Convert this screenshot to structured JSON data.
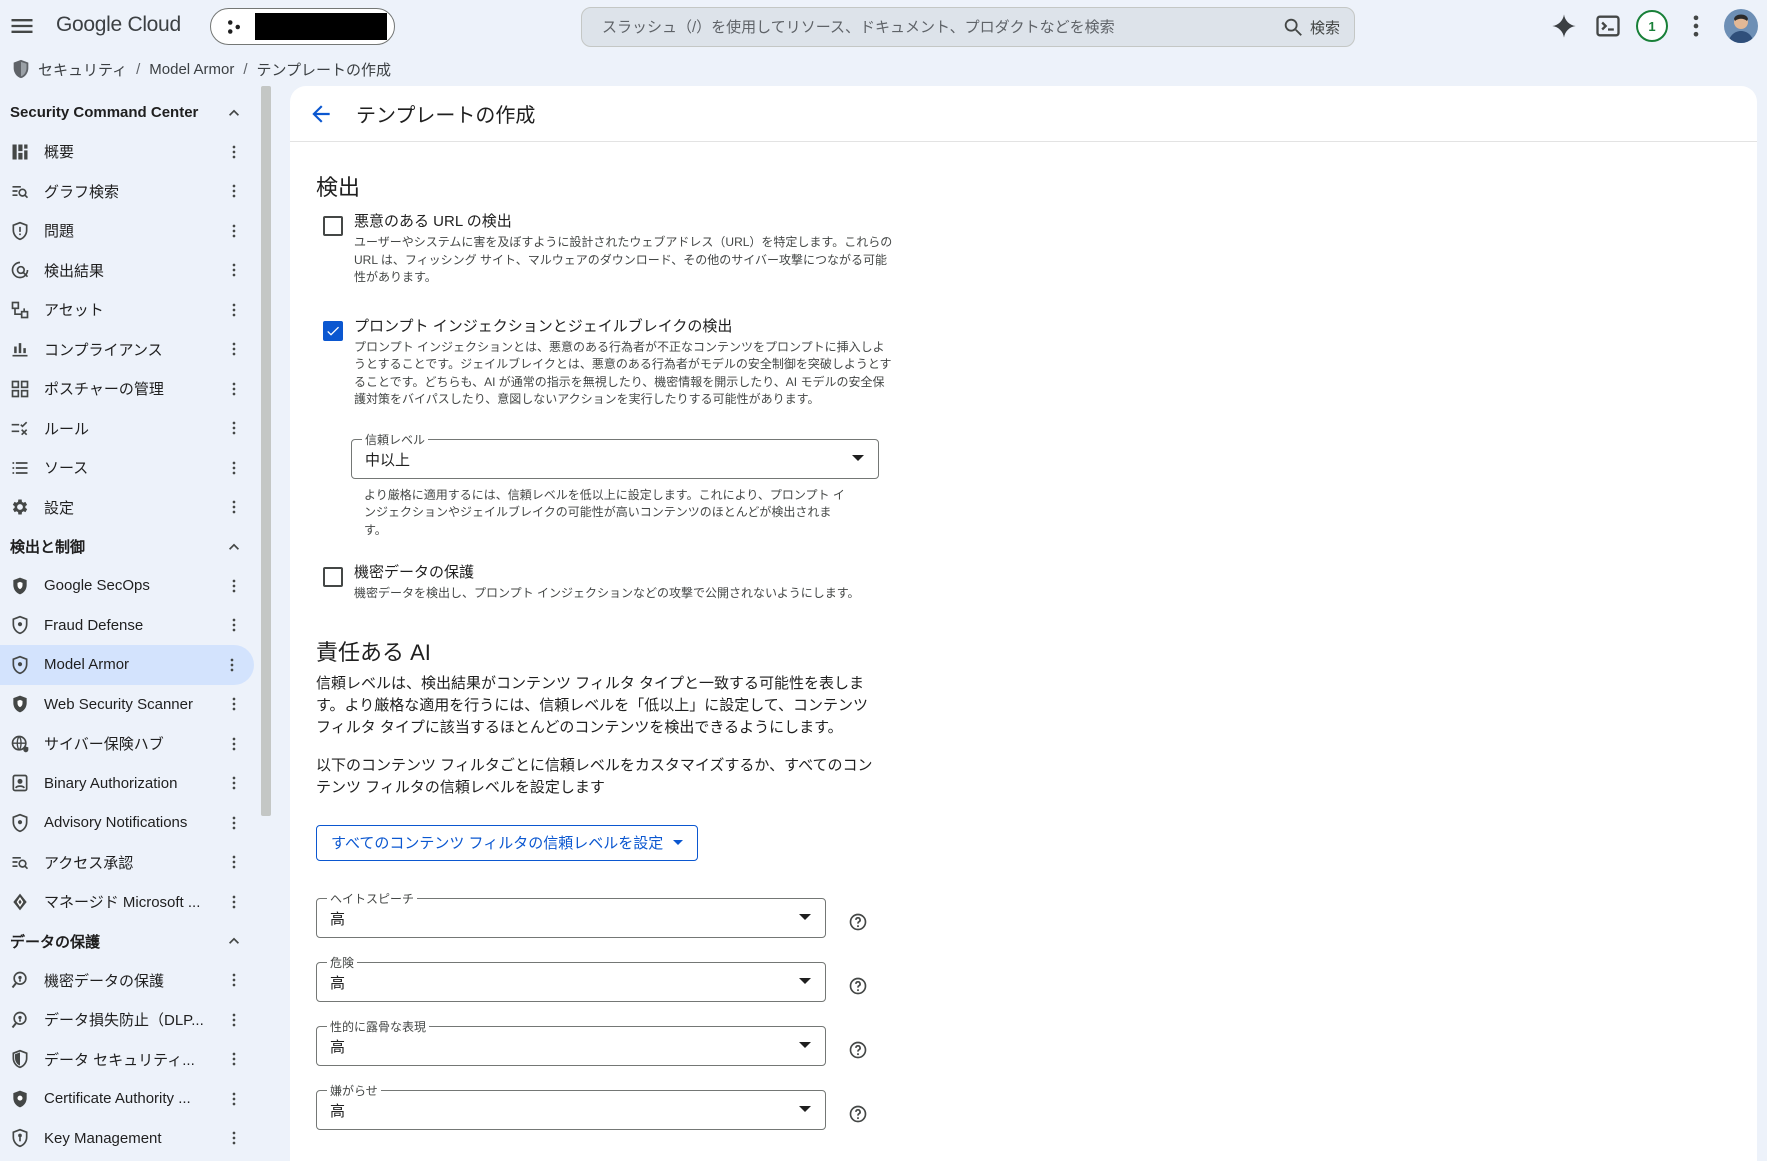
{
  "topbar": {
    "logo": "Google Cloud",
    "search_placeholder": "スラッシュ（/）を使用してリソース、ドキュメント、プロダクトなどを検索",
    "search_button": "検索",
    "notification_count": "1"
  },
  "breadcrumb": [
    "セキュリティ",
    "Model Armor",
    "テンプレートの作成"
  ],
  "sidebar": {
    "sections": [
      {
        "title": "Security Command Center",
        "items": [
          {
            "label": "概要",
            "icon": "dashboard-icon"
          },
          {
            "label": "グラフ検索",
            "icon": "graph-search-icon"
          },
          {
            "label": "問題",
            "icon": "shield-issue-icon"
          },
          {
            "label": "検出結果",
            "icon": "findings-icon"
          },
          {
            "label": "アセット",
            "icon": "asset-icon"
          },
          {
            "label": "コンプライアンス",
            "icon": "compliance-icon"
          },
          {
            "label": "ポスチャーの管理",
            "icon": "posture-icon"
          },
          {
            "label": "ルール",
            "icon": "rule-icon"
          },
          {
            "label": "ソース",
            "icon": "source-icon"
          },
          {
            "label": "設定",
            "icon": "gear-icon"
          }
        ]
      },
      {
        "title": "検出と制御",
        "items": [
          {
            "label": "Google SecOps",
            "icon": "shield-icon"
          },
          {
            "label": "Fraud Defense",
            "icon": "shield-outline-icon"
          },
          {
            "label": "Model Armor",
            "icon": "shield-outline-icon",
            "active": true
          },
          {
            "label": "Web Security Scanner",
            "icon": "shield-icon"
          },
          {
            "label": "サイバー保険ハブ",
            "icon": "globe-icon"
          },
          {
            "label": "Binary Authorization",
            "icon": "badge-icon"
          },
          {
            "label": "Advisory Notifications",
            "icon": "shield-outline-icon"
          },
          {
            "label": "アクセス承認",
            "icon": "access-icon"
          },
          {
            "label": "マネージド Microsoft ...",
            "icon": "microsoft-icon"
          }
        ]
      },
      {
        "title": "データの保護",
        "items": [
          {
            "label": "機密データの保護",
            "icon": "key-search-icon"
          },
          {
            "label": "データ損失防止（DLP...",
            "icon": "key-search-icon"
          },
          {
            "label": "データ セキュリティ...",
            "icon": "shield-half-icon"
          },
          {
            "label": "Certificate Authority ...",
            "icon": "shield-cert-icon"
          },
          {
            "label": "Key Management",
            "icon": "shield-key-icon"
          }
        ]
      }
    ]
  },
  "page": {
    "title": "テンプレートの作成",
    "detection": {
      "heading": "検出",
      "malicious_url": {
        "label": "悪意のある URL の検出",
        "checked": false,
        "desc": "ユーザーやシステムに害を及ぼすように設計されたウェブアドレス（URL）を特定します。これらの URL は、フィッシング サイト、マルウェアのダウンロード、その他のサイバー攻撃につながる可能性があります。"
      },
      "prompt_injection": {
        "label": "プロンプト インジェクションとジェイルブレイクの検出",
        "checked": true,
        "desc": "プロンプト インジェクションとは、悪意のある行為者が不正なコンテンツをプロンプトに挿入しようとすることです。ジェイルブレイクとは、悪意のある行為者がモデルの安全制御を突破しようとすることです。どちらも、AI が通常の指示を無視したり、機密情報を開示したり、AI モデルの安全保護対策をバイパスしたり、意図しないアクションを実行したりする可能性があります。",
        "confidence_label": "信頼レベル",
        "confidence_value": "中以上",
        "helper": "より厳格に適用するには、信頼レベルを低以上に設定します。これにより、プロンプト インジェクションやジェイルブレイクの可能性が高いコンテンツのほとんどが検出されます。"
      },
      "sensitive_data": {
        "label": "機密データの保護",
        "checked": false,
        "desc": "機密データを検出し、プロンプト インジェクションなどの攻撃で公開されないようにします。"
      }
    },
    "responsible_ai": {
      "heading": "責任ある AI",
      "para1": "信頼レベルは、検出結果がコンテンツ フィルタ タイプと一致する可能性を表します。より厳格な適用を行うには、信頼レベルを「低以上」に設定して、コンテンツ フィルタ タイプに該当するほとんどのコンテンツを検出できるようにします。",
      "para2": "以下のコンテンツ フィルタごとに信頼レベルをカスタマイズするか、すべてのコンテンツ フィルタの信頼レベルを設定します",
      "set_all_button": "すべてのコンテンツ フィルタの信頼レベルを設定",
      "filters": [
        {
          "label": "ヘイトスピーチ",
          "value": "高"
        },
        {
          "label": "危険",
          "value": "高"
        },
        {
          "label": "性的に露骨な表現",
          "value": "高"
        },
        {
          "label": "嫌がらせ",
          "value": "高"
        }
      ]
    }
  },
  "colors": {
    "accent": "#0b57d0",
    "background": "#edf2fa",
    "active_nav": "#d3e3fd"
  }
}
